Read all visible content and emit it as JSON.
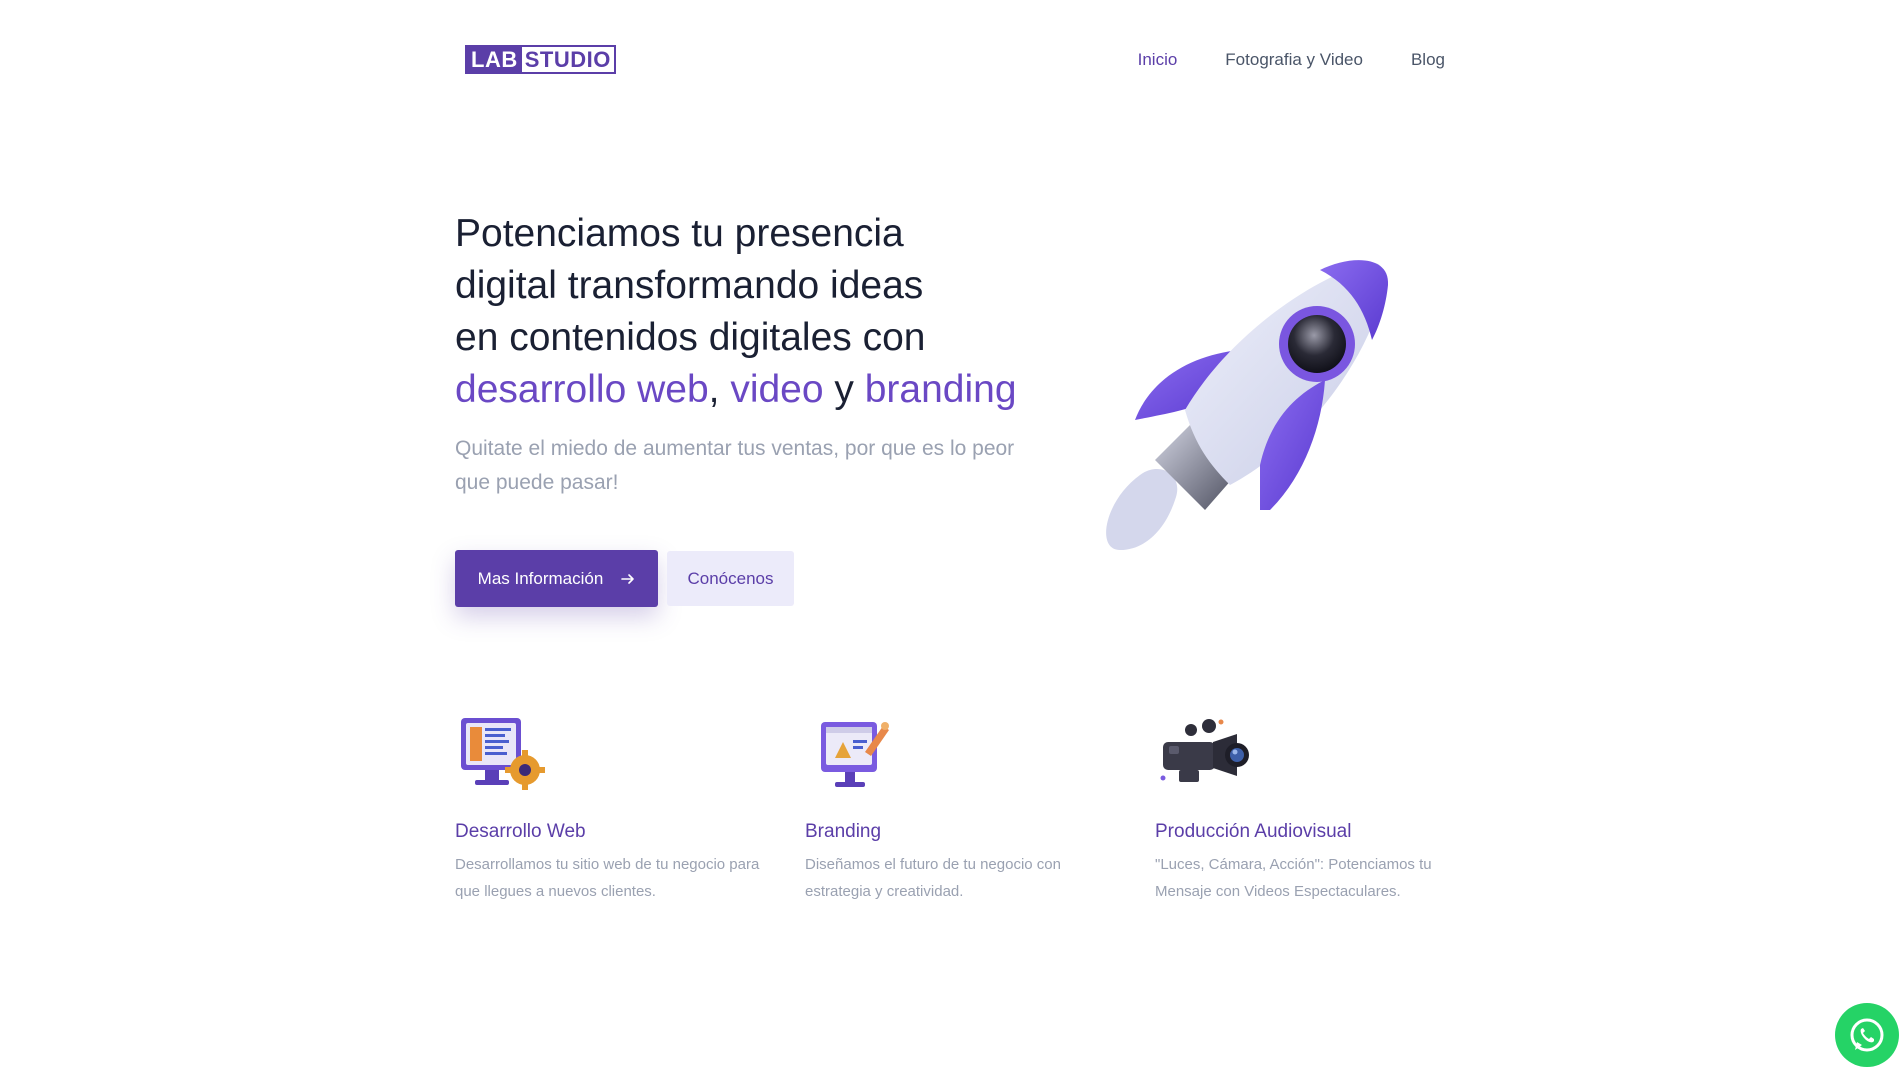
{
  "header": {
    "logo_lab": "LAB",
    "logo_studio": "STUDIO",
    "nav": [
      {
        "label": "Inicio"
      },
      {
        "label": "Fotografia y Video"
      },
      {
        "label": "Blog"
      }
    ]
  },
  "hero": {
    "title_line1": "Potenciamos tu presencia",
    "title_line2": "digital transformando ideas",
    "title_line3": "en contenidos digitales con",
    "hl1": "desarrollo web",
    "sep1": ", ",
    "hl2": "video",
    "sep2": " y ",
    "hl3": "branding",
    "subtitle": "Quitate el miedo de aumentar tus ventas, por que es lo peor que puede pasar!",
    "primary_button": "Mas Información",
    "secondary_button": "Conócenos"
  },
  "features": [
    {
      "title": "Desarrollo Web",
      "text": "Desarrollamos tu sitio web de tu negocio para que llegues a nuevos clientes.",
      "icon": "web-development-icon"
    },
    {
      "title": "Branding",
      "text": "Diseñamos el futuro de tu negocio con estrategia y creatividad.",
      "icon": "branding-icon"
    },
    {
      "title": "Producción Audiovisual",
      "text": "\"Luces, Cámara, Acción\": Potenciamos tu Mensaje con Videos Espectaculares.",
      "icon": "video-camera-icon"
    }
  ],
  "colors": {
    "brand": "#5b3ea8",
    "highlight": "#6a48c4",
    "muted": "#9aa1b1",
    "whatsapp": "#25d366"
  }
}
